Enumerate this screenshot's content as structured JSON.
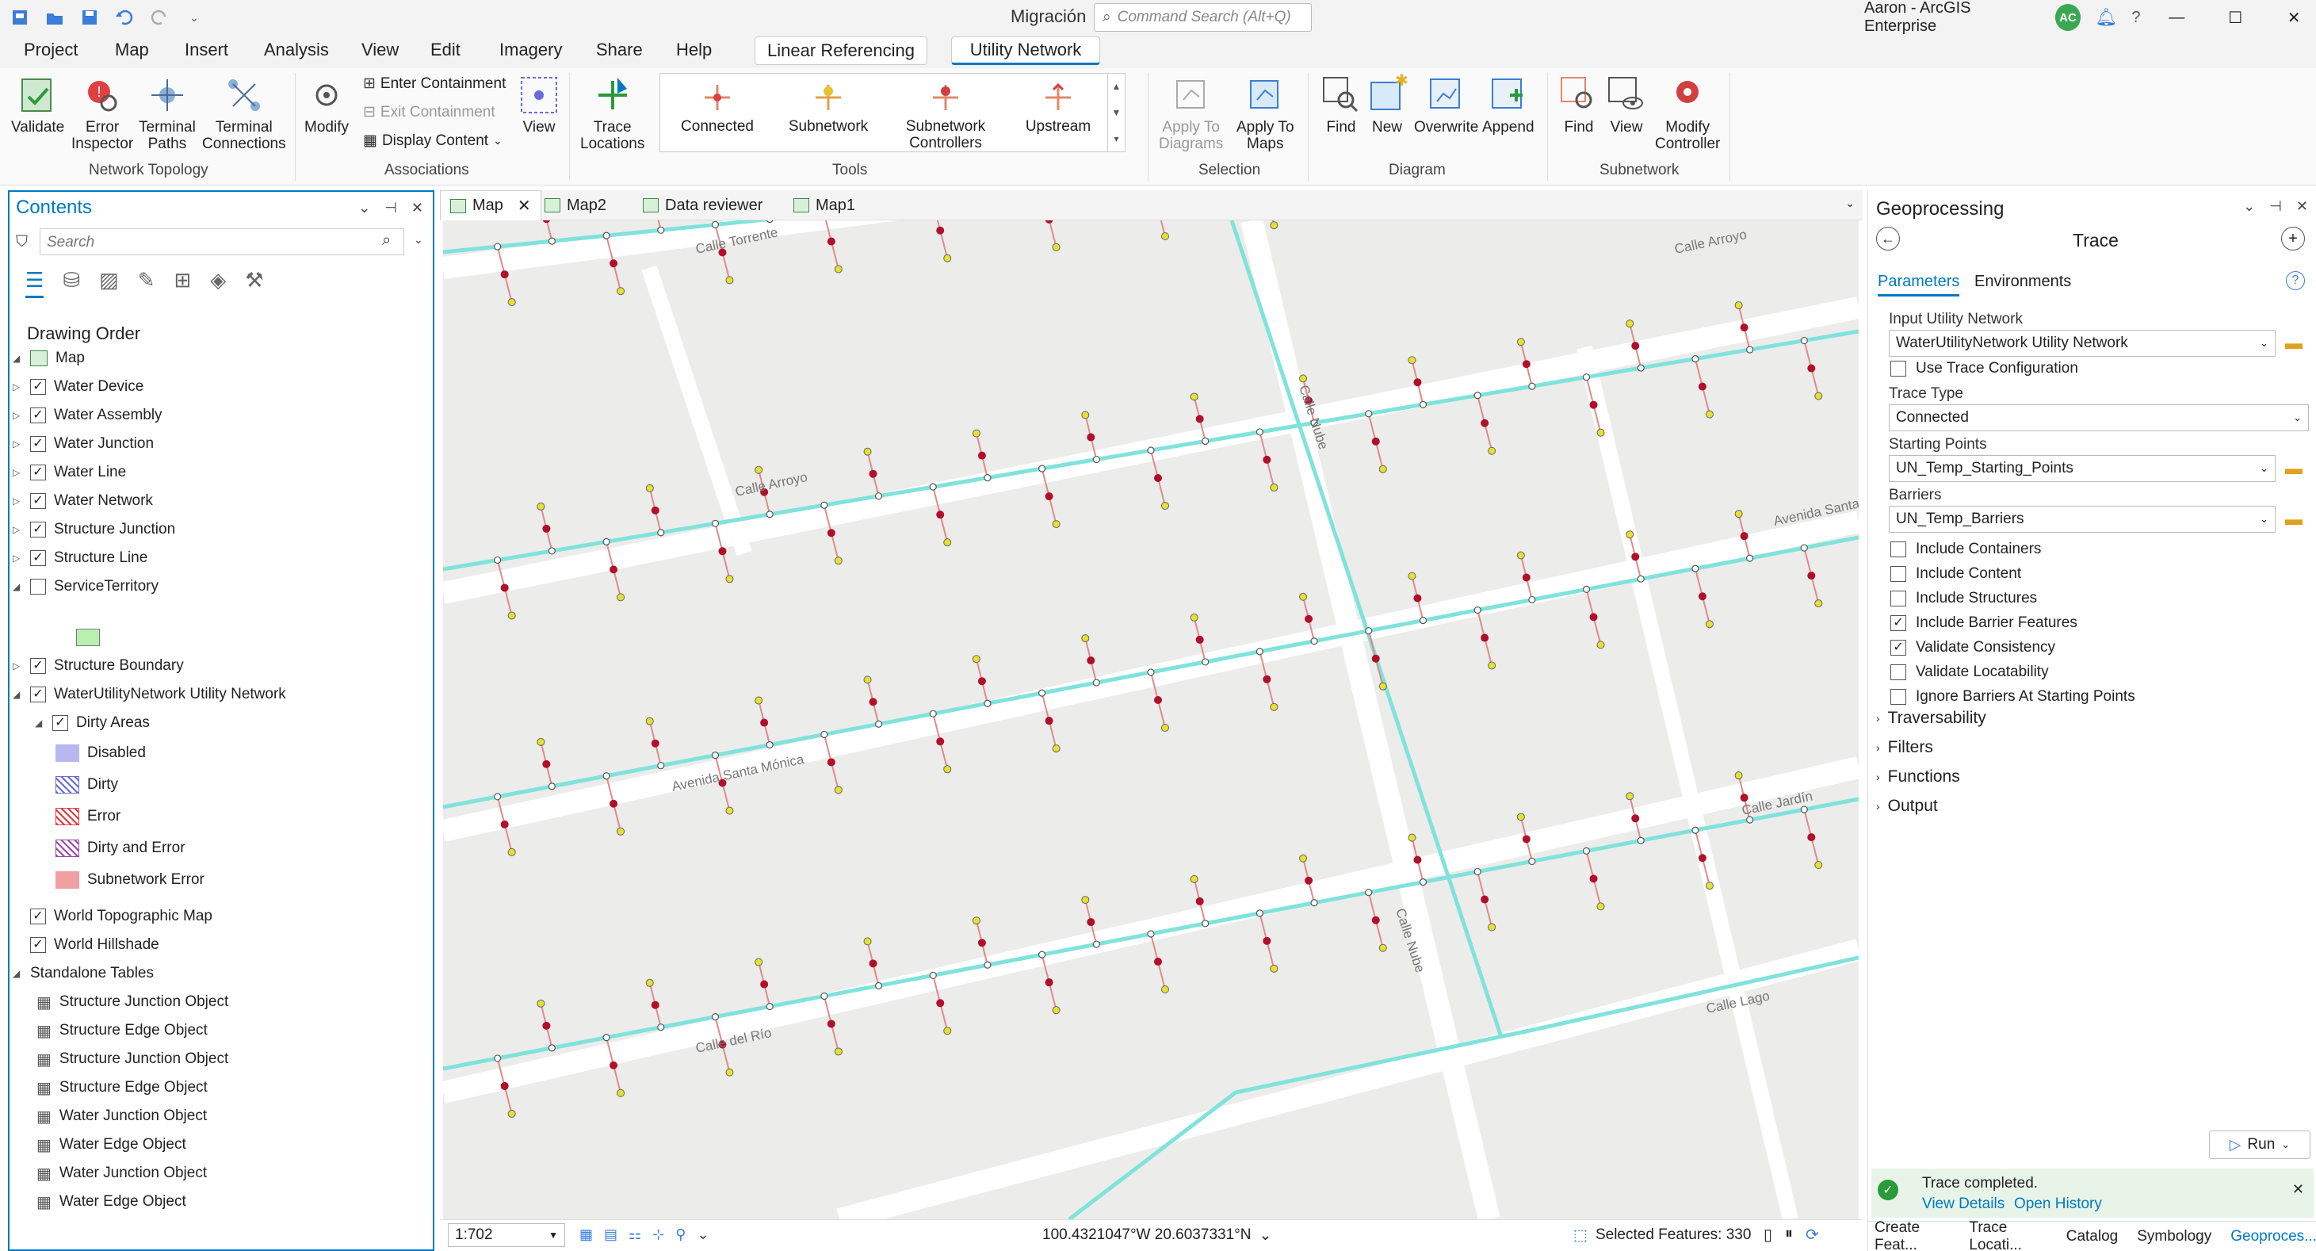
{
  "window": {
    "title": "Migración",
    "search_placeholder": "Command Search (Alt+Q)",
    "user": "Aaron - ArcGIS Enterprise",
    "avatar_initials": "AC"
  },
  "menu_tabs": [
    "Project",
    "Map",
    "Insert",
    "Analysis",
    "View",
    "Edit",
    "Imagery",
    "Share",
    "Help"
  ],
  "context_tabs": {
    "linear_referencing": "Linear Referencing",
    "utility_network": "Utility Network"
  },
  "ribbon": {
    "network_topology": {
      "label": "Network Topology",
      "validate": "Validate",
      "error_inspector_1": "Error",
      "error_inspector_2": "Inspector",
      "terminal_paths_1": "Terminal",
      "terminal_paths_2": "Paths",
      "terminal_conn_1": "Terminal",
      "terminal_conn_2": "Connections"
    },
    "associations": {
      "label": "Associations",
      "modify": "Modify",
      "enter_containment": "Enter Containment",
      "exit_containment": "Exit Containment",
      "display_content": "Display Content",
      "view": "View"
    },
    "trace": {
      "trace_locations_1": "Trace",
      "trace_locations_2": "Locations"
    },
    "tools": {
      "label": "Tools",
      "connected": "Connected",
      "subnetwork": "Subnetwork",
      "subnetwork_controllers_1": "Subnetwork",
      "subnetwork_controllers_2": "Controllers",
      "upstream": "Upstream"
    },
    "selection": {
      "label": "Selection",
      "apply_diagrams_1": "Apply To",
      "apply_diagrams_2": "Diagrams",
      "apply_maps_1": "Apply To",
      "apply_maps_2": "Maps"
    },
    "diagram": {
      "label": "Diagram",
      "find": "Find",
      "new": "New",
      "overwrite": "Overwrite",
      "append": "Append"
    },
    "subnetwork": {
      "label": "Subnetwork",
      "find": "Find",
      "view": "View",
      "modify_controller_1": "Modify",
      "modify_controller_2": "Controller"
    }
  },
  "contents": {
    "title": "Contents",
    "search_placeholder": "Search",
    "drawing_order": "Drawing Order",
    "map_label": "Map",
    "layers": [
      {
        "label": "Water Device",
        "checked": true
      },
      {
        "label": "Water Assembly",
        "checked": true
      },
      {
        "label": "Water Junction",
        "checked": true
      },
      {
        "label": "Water Line",
        "checked": true
      },
      {
        "label": "Water Network",
        "checked": true
      },
      {
        "label": "Structure Junction",
        "checked": true
      },
      {
        "label": "Structure Line",
        "checked": true
      },
      {
        "label": "ServiceTerritory",
        "checked": false
      }
    ],
    "structure_boundary": "Structure Boundary",
    "utility_network": "WaterUtilityNetwork Utility Network",
    "dirty_areas": "Dirty Areas",
    "legend": [
      {
        "label": "Disabled",
        "color": "#b8b8f0"
      },
      {
        "label": "Dirty",
        "color": "#6a6ad8"
      },
      {
        "label": "Error",
        "color": "#e03a3a"
      },
      {
        "label": "Dirty and Error",
        "color": "#9a4aa8"
      },
      {
        "label": "Subnetwork Error",
        "color": "#f0a0a0"
      }
    ],
    "basemaps": [
      "World Topographic Map",
      "World Hillshade"
    ],
    "standalone_tables": "Standalone Tables",
    "tables": [
      "Structure Junction Object",
      "Structure Edge Object",
      "Structure Junction Object",
      "Structure Edge Object",
      "Water Junction Object",
      "Water Edge Object",
      "Water Junction Object",
      "Water Edge Object"
    ]
  },
  "map_tabs": [
    "Map",
    "Map2",
    "Data reviewer",
    "Map1"
  ],
  "map": {
    "streets": [
      "Calle Torrente",
      "Calle Arroyo",
      "Calle Arroyo",
      "Calle Nube",
      "Avenida Santa Mónica",
      "Avenida Santa",
      "Calle Nube",
      "Calle del Río",
      "Calle Lago",
      "Calle Jardín"
    ],
    "scale": "1:702",
    "coordinates": "100.4321047°W 20.6037331°N",
    "selected_features": "Selected Features: 330"
  },
  "gp": {
    "title": "Geoprocessing",
    "tool": "Trace",
    "tab_parameters": "Parameters",
    "tab_environments": "Environments",
    "input_un_label": "Input Utility Network",
    "input_un_value": "WaterUtilityNetwork Utility Network",
    "use_trace_config": "Use Trace Configuration",
    "trace_type_label": "Trace Type",
    "trace_type_value": "Connected",
    "starting_points_label": "Starting Points",
    "starting_points_value": "UN_Temp_Starting_Points",
    "barriers_label": "Barriers",
    "barriers_value": "UN_Temp_Barriers",
    "options": [
      {
        "label": "Include Containers",
        "checked": false
      },
      {
        "label": "Include Content",
        "checked": false
      },
      {
        "label": "Include Structures",
        "checked": false
      },
      {
        "label": "Include Barrier Features",
        "checked": true
      },
      {
        "label": "Validate Consistency",
        "checked": true
      },
      {
        "label": "Validate Locatability",
        "checked": false
      },
      {
        "label": "Ignore Barriers At Starting Points",
        "checked": false
      }
    ],
    "sections": [
      "Traversability",
      "Filters",
      "Functions",
      "Output"
    ],
    "run": "Run",
    "message": "Trace completed.",
    "view_details": "View Details",
    "open_history": "Open History",
    "bottom_tabs": [
      "Create Feat...",
      "Trace Locati...",
      "Catalog",
      "Symbology",
      "Geoproces..."
    ]
  },
  "colors": {
    "accent": "#0079c1",
    "trace_line": "#7fe3dc",
    "lateral": "#e08a8a",
    "node_red": "#b0102a",
    "node_yellow": "#e8e030"
  }
}
